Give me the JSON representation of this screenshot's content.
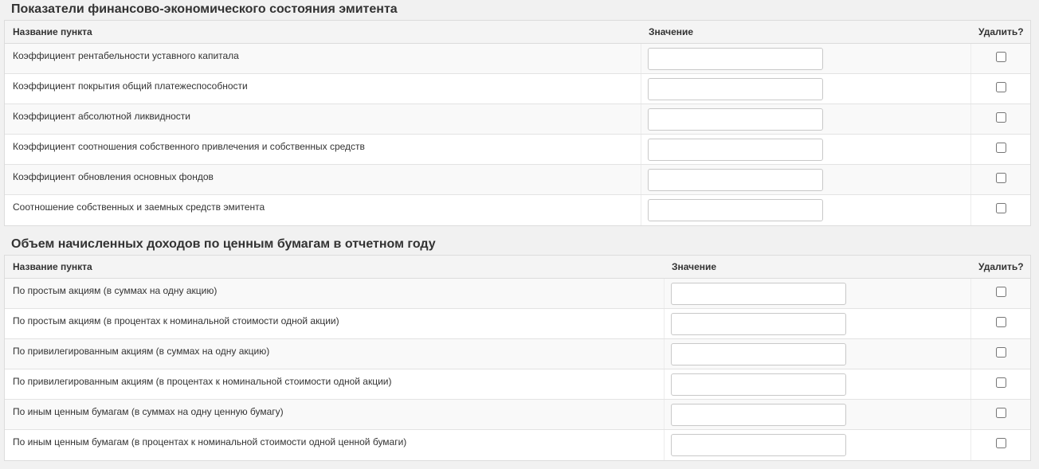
{
  "sections": [
    {
      "title": "Показатели финансово-экономического состояния эмитента",
      "columns": {
        "name": "Название пункта",
        "value": "Значение",
        "delete": "Удалить?"
      },
      "rows": [
        {
          "label": "Коэффициент рентабельности уставного капитала",
          "value": "",
          "delete": false
        },
        {
          "label": "Коэффициент покрытия общий платежеспособности",
          "value": "",
          "delete": false
        },
        {
          "label": "Коэффициент абсолютной ликвидности",
          "value": "",
          "delete": false
        },
        {
          "label": "Коэффициент соотношения собственного привлечения и собственных средств",
          "value": "",
          "delete": false
        },
        {
          "label": "Коэффициент обновления основных фондов",
          "value": "",
          "delete": false
        },
        {
          "label": "Соотношение собственных и заемных средств эмитента",
          "value": "",
          "delete": false
        }
      ]
    },
    {
      "title": "Объем начисленных доходов по ценным бумагам в отчетном году",
      "columns": {
        "name": "Название пункта",
        "value": "Значение",
        "delete": "Удалить?"
      },
      "rows": [
        {
          "label": "По простым акциям (в суммах на одну акцию)",
          "value": "",
          "delete": false
        },
        {
          "label": "По простым акциям (в процентах к номинальной стоимости одной акции)",
          "value": "",
          "delete": false
        },
        {
          "label": "По привилегированным акциям (в суммах на одну акцию)",
          "value": "",
          "delete": false
        },
        {
          "label": "По привилегированным акциям (в процентах к номинальной стоимости одной акции)",
          "value": "",
          "delete": false
        },
        {
          "label": "По иным ценным бумагам (в суммах на одну ценную бумагу)",
          "value": "",
          "delete": false
        },
        {
          "label": "По иным ценным бумагам (в процентах к номинальной стоимости одной ценной бумаги)",
          "value": "",
          "delete": false
        }
      ]
    }
  ]
}
